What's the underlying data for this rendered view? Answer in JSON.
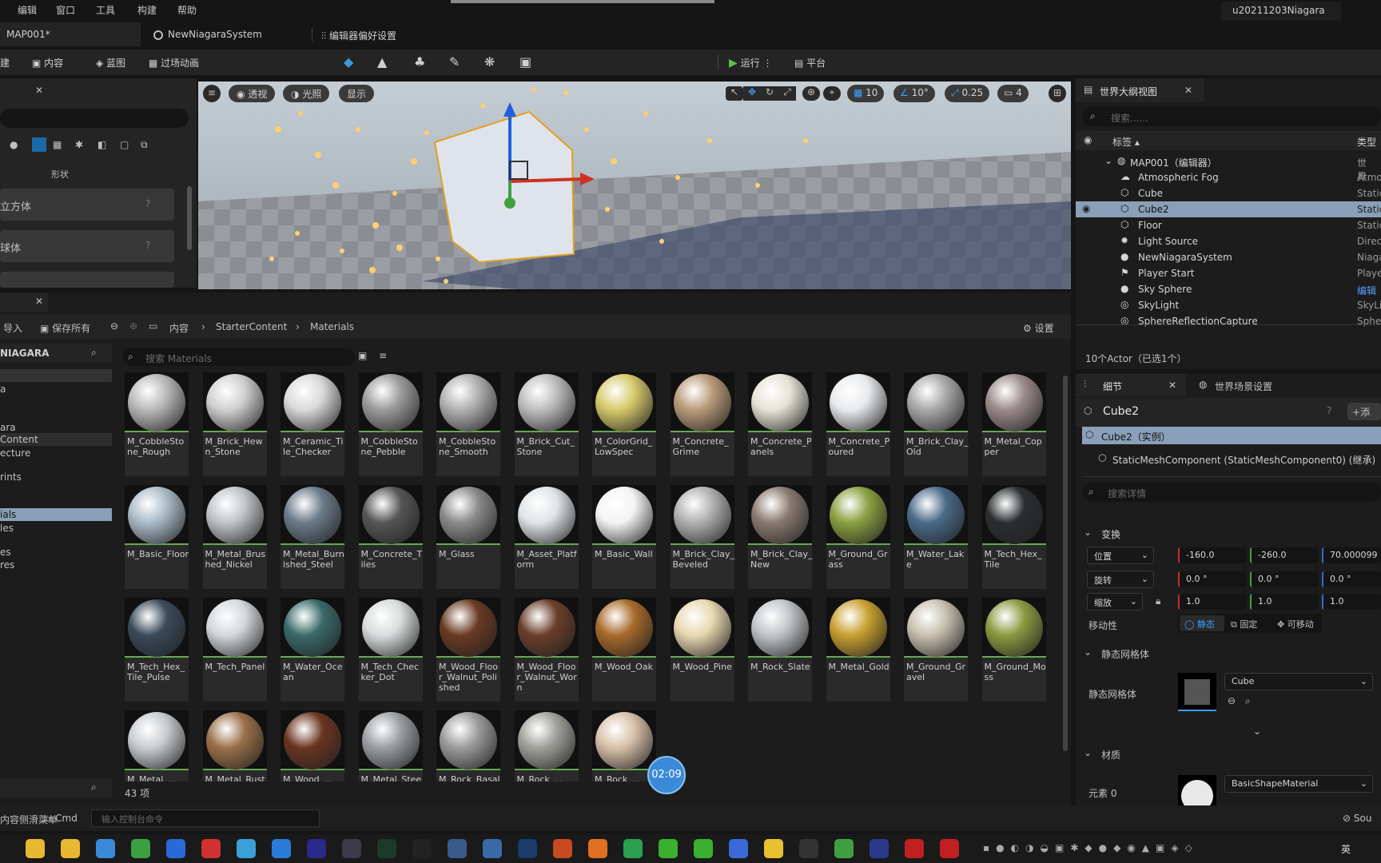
{
  "menu": [
    "编辑",
    "窗口",
    "工具",
    "构建",
    "帮助"
  ],
  "project_name": "u20211203Niagara",
  "tabs": {
    "map": "MAP001*",
    "niagara": "NewNiagaraSystem",
    "prefs": "编辑器偏好设置"
  },
  "toolbar": {
    "create": "创建",
    "content": "内容",
    "blueprint": "蓝图",
    "cinematics": "过场动画",
    "run": "运行",
    "platform": "平台"
  },
  "place_panel": {
    "shapes_label": "形状",
    "item1": "立方体",
    "item2": "球体"
  },
  "viewport": {
    "perspective": "透视",
    "lit": "光照",
    "show": "显示",
    "grid_snap": "10",
    "rot_snap": "10°",
    "scale_snap": "0.25",
    "cam_speed": "4"
  },
  "outliner": {
    "title": "世界大纲视图",
    "search_placeholder": "搜索......",
    "col_label": "标签",
    "col_type": "类型",
    "root": "MAP001（编辑器）",
    "root_type": "世界",
    "items": [
      {
        "label": "Atmospheric Fog",
        "type": "Atmo"
      },
      {
        "label": "Cube",
        "type": "Static"
      },
      {
        "label": "Cube2",
        "type": "Static"
      },
      {
        "label": "Floor",
        "type": "Static"
      },
      {
        "label": "Light Source",
        "type": "Direc"
      },
      {
        "label": "NewNiagaraSystem",
        "type": "Niaga"
      },
      {
        "label": "Player Start",
        "type": "Playe"
      },
      {
        "label": "Sky Sphere",
        "type": "编辑"
      },
      {
        "label": "SkyLight",
        "type": "SkyLi"
      },
      {
        "label": "SphereReflectionCapture",
        "type": "Sphe"
      }
    ],
    "footer": "10个Actor（已选1个）"
  },
  "details": {
    "tab1": "细节",
    "tab2": "世界场景设置",
    "actor_name": "Cube2",
    "add_label": "添",
    "instance": "Cube2（实例）",
    "component": "StaticMeshComponent (StaticMeshComponent0) (继承)",
    "search_placeholder": "搜索详情",
    "transform_section": "变换",
    "location_label": "位置",
    "rotation_label": "旋转",
    "scale_label": "缩放",
    "location": [
      "-160.0",
      "-260.0",
      "70.000099"
    ],
    "rotation": [
      "0.0 °",
      "0.0 °",
      "0.0 °"
    ],
    "scale": [
      "1.0",
      "1.0",
      "1.0"
    ],
    "mobility_label": "移动性",
    "mobility": [
      "静态",
      "固定",
      "可移动"
    ],
    "static_mesh_section": "静态网格体",
    "static_mesh_label": "静态网格体",
    "static_mesh_value": "Cube",
    "material_section": "材质",
    "element0_label": "元素 0",
    "material_value": "BasicShapeMaterial"
  },
  "content_browser": {
    "import": "导入",
    "save_all": "保存所有",
    "breadcrumb": [
      "内容",
      "StarterContent",
      "Materials"
    ],
    "settings": "设置",
    "sidebar_header": "NIAGARA",
    "sidebar_items": [
      "a",
      "ara",
      "Content",
      "ecture",
      "rints",
      "ials",
      "les",
      "es",
      "res"
    ],
    "search_placeholder": "搜索 Materials",
    "count": "43 项",
    "assets": [
      {
        "name": "M_CobbleStone_Rough",
        "color": "#b8b8b8"
      },
      {
        "name": "M_Brick_Hewn_Stone",
        "color": "#cfcfcf"
      },
      {
        "name": "M_Ceramic_Tile_Checker",
        "color": "#d8d8d8"
      },
      {
        "name": "M_CobbleStone_Pebble",
        "color": "#9a9a9a"
      },
      {
        "name": "M_CobbleStone_Smooth",
        "color": "#b0b0b0"
      },
      {
        "name": "M_Brick_Cut_Stone",
        "color": "#bdbdbd"
      },
      {
        "name": "M_ColorGrid_LowSpec",
        "color": "#d6c96a"
      },
      {
        "name": "M_Concrete_Grime",
        "color": "#b89a78"
      },
      {
        "name": "M_Concrete_Panels",
        "color": "#e6e2d6"
      },
      {
        "name": "M_Concrete_Poured",
        "color": "#e8eaec"
      },
      {
        "name": "M_Brick_Clay_Old",
        "color": "#a8a8a8"
      },
      {
        "name": "M_Metal_Copper",
        "color": "#9a8a8a"
      },
      {
        "name": "M_Basic_Floor",
        "color": "#aabbc8"
      },
      {
        "name": "M_Metal_Brushed_Nickel",
        "color": "#c0c4c8"
      },
      {
        "name": "M_Metal_Burnished_Steel",
        "color": "#6a7a88"
      },
      {
        "name": "M_Concrete_Tiles",
        "color": "#555555"
      },
      {
        "name": "M_Glass",
        "color": "#8a8a8a"
      },
      {
        "name": "M_Asset_Platform",
        "color": "#e0e4e8"
      },
      {
        "name": "M_Basic_Wall",
        "color": "#f4f4f4"
      },
      {
        "name": "M_Brick_Clay_Beveled",
        "color": "#b0b0b0"
      },
      {
        "name": "M_Brick_Clay_New",
        "color": "#8a7a70"
      },
      {
        "name": "M_Ground_Grass",
        "color": "#8aa040"
      },
      {
        "name": "M_Water_Lake",
        "color": "#4a6a88"
      },
      {
        "name": "M_Tech_Hex_Tile",
        "color": "#2a2e30"
      },
      {
        "name": "M_Tech_Hex_Tile_Pulse",
        "color": "#3a4a5a"
      },
      {
        "name": "M_Tech_Panel",
        "color": "#d4d8dc"
      },
      {
        "name": "M_Water_Ocean",
        "color": "#3a6a6a"
      },
      {
        "name": "M_Tech_Checker_Dot",
        "color": "#d8dcdc"
      },
      {
        "name": "M_Wood_Floor_Walnut_Polished",
        "color": "#6a3a22"
      },
      {
        "name": "M_Wood_Floor_Walnut_Worn",
        "color": "#6a3e2a"
      },
      {
        "name": "M_Wood_Oak",
        "color": "#a86a2a"
      },
      {
        "name": "M_Wood_Pine",
        "color": "#e8d8b0"
      },
      {
        "name": "M_Rock_Slate",
        "color": "#c0c4c8"
      },
      {
        "name": "M_Metal_Gold",
        "color": "#c8a030"
      },
      {
        "name": "M_Ground_Gravel",
        "color": "#c8c0b0"
      },
      {
        "name": "M_Ground_Moss",
        "color": "#8a9a40"
      },
      {
        "name": "M_Metal_...",
        "color": "#c8ccd0"
      },
      {
        "name": "M_Metal_Rust",
        "color": "#9a7048"
      },
      {
        "name": "M_Wood_...",
        "color": "#6a3520"
      },
      {
        "name": "M_Metal_Steel",
        "color": "#9a9ea2"
      },
      {
        "name": "M_Rock_Basalt",
        "color": "#9a9a9a"
      },
      {
        "name": "M_Rock_...",
        "color": "#a0a09a"
      },
      {
        "name": "M_Rock_...",
        "color": "#d8c0a8"
      }
    ]
  },
  "timer": "02:09",
  "bottom": {
    "content_drawer": "内容侧滑菜单",
    "cmd": "Cmd",
    "console_placeholder": "输入控制台命令",
    "source": "Sou"
  },
  "taskbar_icons": [
    "folder-icon",
    "folder-icon",
    "monitor-icon",
    "chrome-icon",
    "apps-icon",
    "bird-icon",
    "photos-icon",
    "vscode-icon",
    "ae-icon",
    "davinci-icon",
    "pt-icon",
    "unreal-icon",
    "network-icon",
    "window-icon",
    "ps-icon",
    "m-icon",
    "blender-icon",
    "x-icon",
    "iqiyi-icon",
    "iqiyi-icon",
    "c-icon",
    "leaf-icon",
    "epic-icon",
    "plus-icon",
    "au-icon",
    "sw-icon",
    "dict-icon"
  ],
  "tray_text": "英"
}
